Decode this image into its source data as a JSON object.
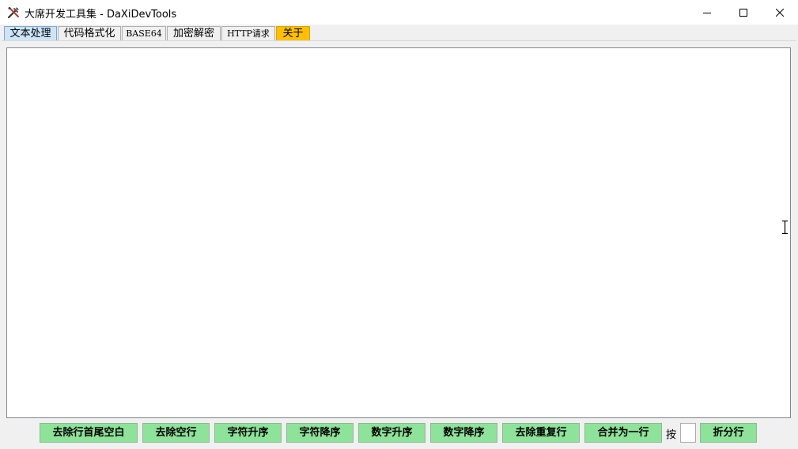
{
  "window": {
    "title": "大席开发工具集 - DaXiDevTools",
    "app_icon": "tools-icon",
    "controls": [
      "minimize-icon",
      "maximize-icon",
      "close-icon"
    ]
  },
  "tabs": [
    {
      "label": "文本处理",
      "selected": true
    },
    {
      "label": "代码格式化"
    },
    {
      "label": "BASE64"
    },
    {
      "label": "加密解密"
    },
    {
      "label": "HTTP请求"
    },
    {
      "label": "关于",
      "highlight_color": "#ffc000"
    }
  ],
  "editor": {
    "value": ""
  },
  "actions": {
    "trim_whitespace": "去除行首尾空白",
    "remove_blank_lines": "去除空行",
    "sort_chars_asc": "字符升序",
    "sort_chars_desc": "字符降序",
    "sort_numbers_asc": "数字升序",
    "sort_numbers_desc": "数字降序",
    "remove_duplicate_lines": "去除重复行",
    "merge_to_one_line": "合并为一行",
    "by_label": "按",
    "split_count_value": "",
    "split_lines": "折分行"
  },
  "colors": {
    "action_button_bg": "#8ee39a",
    "selected_tab_bg": "#cce4f7",
    "about_tab_bg": "#ffc000"
  }
}
